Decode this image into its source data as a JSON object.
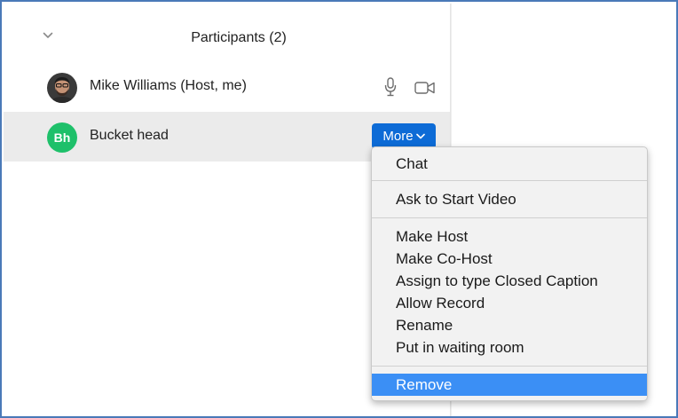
{
  "panel": {
    "title": "Participants (2)"
  },
  "participants": [
    {
      "name": "Mike Williams (Host, me)",
      "avatar_type": "photo"
    },
    {
      "name": "Bucket head",
      "initials": "Bh",
      "avatar_color": "#1ec06a"
    }
  ],
  "more_button": {
    "label": "More"
  },
  "menu": {
    "items": [
      "Chat",
      "Ask to Start Video",
      "Make Host",
      "Make Co-Host",
      "Assign to type Closed Caption",
      "Allow Record",
      "Rename",
      "Put in waiting room",
      "Remove"
    ],
    "selected_index": 8
  },
  "colors": {
    "accent": "#0d6bd6",
    "selection": "#3b8ff5",
    "frame_border": "#4a79b8"
  }
}
